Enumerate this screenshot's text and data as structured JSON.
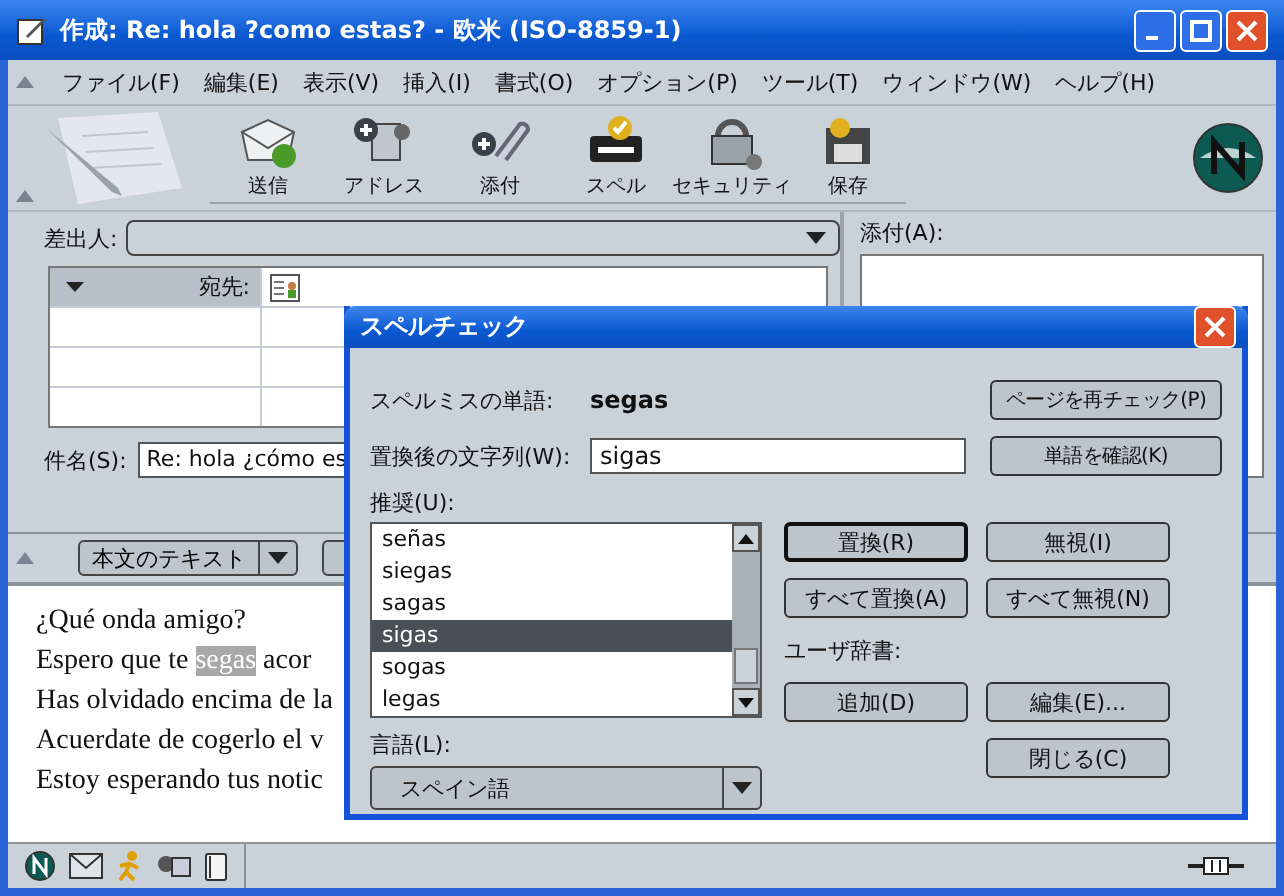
{
  "window": {
    "title": "作成: Re: hola ?como estas? - 欧米 (ISO-8859-1)"
  },
  "menu": [
    "ファイル(F)",
    "編集(E)",
    "表示(V)",
    "挿入(I)",
    "書式(O)",
    "オプション(P)",
    "ツール(T)",
    "ウィンドウ(W)",
    "ヘルプ(H)"
  ],
  "toolbar": [
    {
      "label": "送信",
      "kind": "send"
    },
    {
      "label": "アドレス",
      "kind": "address"
    },
    {
      "label": "添付",
      "kind": "attach"
    },
    {
      "label": "スペル",
      "kind": "spell"
    },
    {
      "label": "セキュリティ",
      "kind": "security"
    },
    {
      "label": "保存",
      "kind": "save"
    }
  ],
  "header": {
    "from_label": "差出人:",
    "to_label": "宛先:",
    "subject_label": "件名(S):",
    "subject_value": "Re: hola ¿cómo es",
    "attach_label": "添付(A):"
  },
  "format_bar": {
    "text_button": "本文のテキスト"
  },
  "body": {
    "lines": [
      [
        {
          "text": "¿Qué onda amigo?",
          "highlight": false
        }
      ],
      [
        {
          "text": "Espero que te ",
          "highlight": false
        },
        {
          "text": "segas",
          "highlight": true
        },
        {
          "text": " acor",
          "highlight": false
        }
      ],
      [
        {
          "text": "Has olvidado encima de la",
          "highlight": false
        }
      ],
      [
        {
          "text": "Acuerdate de cogerlo el v",
          "highlight": false
        }
      ],
      [
        {
          "text": "Estoy esperando tus notic",
          "highlight": false
        }
      ]
    ]
  },
  "dialog": {
    "title": "スペルチェック",
    "misspelled_label": "スペルミスの単語:",
    "misspelled_word": "segas",
    "replace_label": "置換後の文字列(W):",
    "replace_value": "sigas",
    "recheck_button": "ページを再チェック(P)",
    "check_word_button": "単語を確認(K)",
    "suggestions_label": "推奨(U):",
    "suggestions": [
      {
        "text": "señas",
        "selected": false
      },
      {
        "text": "siegas",
        "selected": false
      },
      {
        "text": "sagas",
        "selected": false
      },
      {
        "text": "sigas",
        "selected": true
      },
      {
        "text": "sogas",
        "selected": false
      },
      {
        "text": "legas",
        "selected": false
      }
    ],
    "replace_button": "置換(R)",
    "ignore_button": "無視(I)",
    "replace_all_button": "すべて置換(A)",
    "ignore_all_button": "すべて無視(N)",
    "user_dict_label": "ユーザ辞書:",
    "add_button": "追加(D)",
    "edit_button": "編集(E)...",
    "language_label": "言語(L):",
    "language": "スペイン語",
    "close_button": "閉じる(C)"
  }
}
